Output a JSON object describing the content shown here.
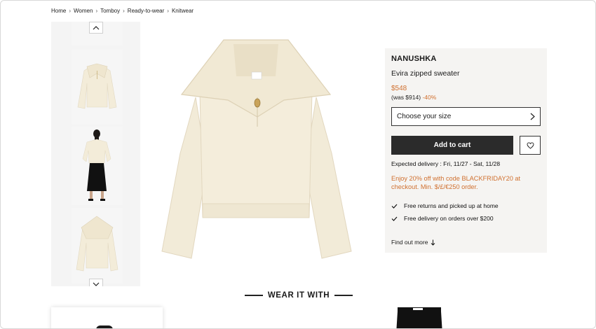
{
  "breadcrumb": [
    "Home",
    "Women",
    "Tomboy",
    "Ready-to-wear",
    "Knitwear"
  ],
  "thumbnails": {
    "up_icon": "chevron-up-icon",
    "down_icon": "chevron-down-icon"
  },
  "product": {
    "brand": "NANUSHKA",
    "name": "Evira zipped sweater",
    "price": "$548",
    "was_prefix": "(was $914)",
    "discount": "-40%",
    "size_placeholder": "Choose your size",
    "add_to_cart": "Add to cart",
    "delivery": "Expected delivery : Fri, 11/27 - Sat, 11/28",
    "promo": "Enjoy 20% off with code BLACKFRIDAY20 at checkout. Min. $/£/€250 order.",
    "benefits": [
      "Free returns and picked up at home",
      "Free delivery on orders over $200"
    ],
    "find_more": "Find out more"
  },
  "wear_it_with": {
    "title": "WEAR IT WITH"
  },
  "colors": {
    "accent": "#d0702f",
    "button_dark": "#2b2b2b",
    "panel_bg": "#f5f4f2",
    "sweater": "#f3ecd9"
  }
}
